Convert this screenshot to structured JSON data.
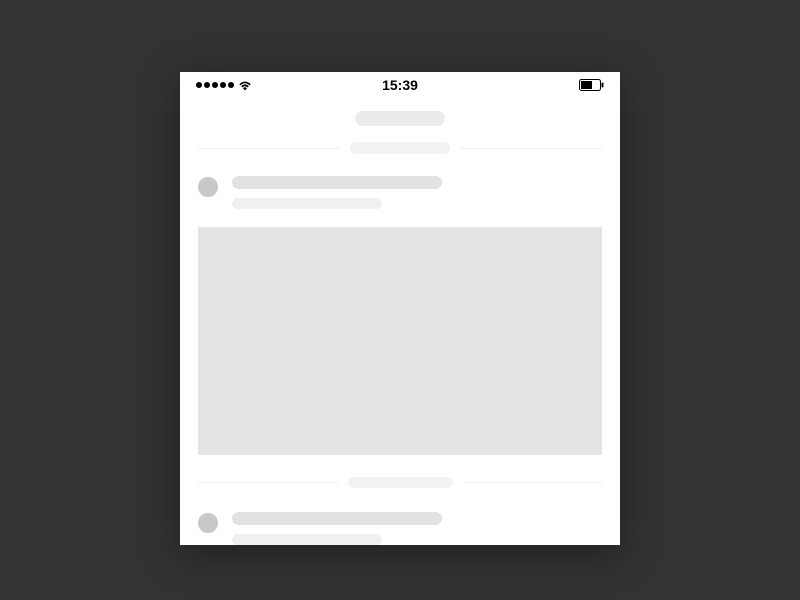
{
  "status_bar": {
    "time": "15:39",
    "signal_dots": 5,
    "wifi": true,
    "battery_level": 0.52
  },
  "skeleton": {
    "header_title": "",
    "divider_label": "",
    "feed": [
      {
        "avatar": "",
        "line1": "",
        "line2": "",
        "has_image": true
      },
      {
        "avatar": "",
        "line1": "",
        "line2": "",
        "has_image": false
      }
    ],
    "divider_label_2": ""
  }
}
